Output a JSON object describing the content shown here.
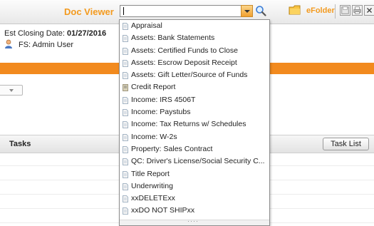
{
  "header": {
    "title": "Doc Viewer",
    "efolder_label": "eFolder",
    "search_value": ""
  },
  "info": {
    "closing_label": "Est Closing Date:",
    "closing_date": "01/27/2016",
    "user": "FS: Admin User"
  },
  "tasks": {
    "label": "Tasks",
    "button_label": "Task List"
  },
  "document_types": [
    "Appraisal",
    "Assets: Bank Statements",
    "Assets: Certified Funds to Close",
    "Assets: Escrow Deposit Receipt",
    "Assets: Gift Letter/Source of Funds",
    "Credit Report",
    "Income: IRS 4506T",
    "Income: Paystubs",
    "Income: Tax Returns w/ Schedules",
    "Income: W-2s",
    "Property: Sales Contract",
    "QC: Driver's License/Social Security C...",
    "Title Report",
    "Underwriting",
    "xxDELETExx",
    "xxDO NOT SHIPxx"
  ],
  "colors": {
    "accent": "#f39a1e",
    "band": "#f28a1e"
  },
  "icons": {
    "search": "magnifier-icon",
    "efolder": "folder-icon",
    "save": "save-icon",
    "print": "print-icon",
    "close": "close-icon",
    "user": "user-icon",
    "doc": "document-icon"
  }
}
